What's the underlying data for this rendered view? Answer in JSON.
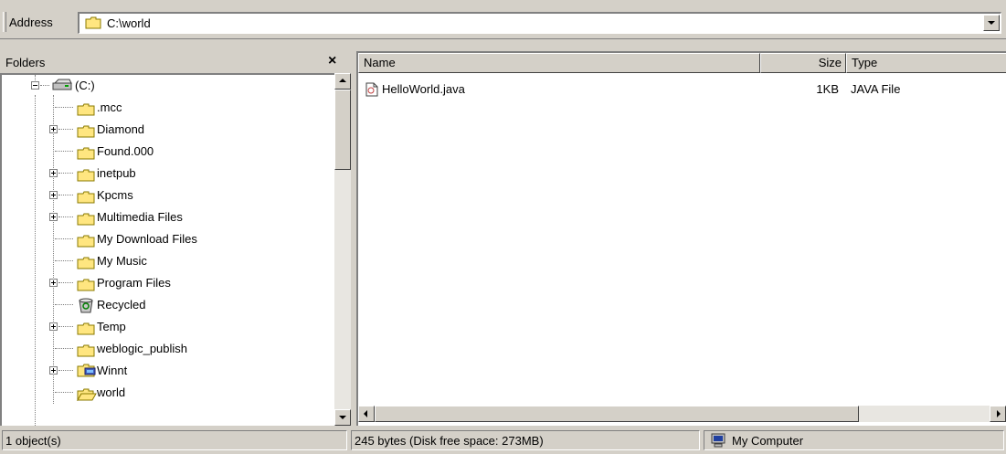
{
  "address_bar": {
    "label": "Address",
    "value": "C:\\world"
  },
  "folders_pane": {
    "title": "Folders",
    "close_label": "×",
    "tree": [
      {
        "label": "(C:)",
        "icon": "drive-icon",
        "expander": "expanded"
      },
      {
        "label": ".mcc",
        "icon": "folder-icon",
        "expander": "none"
      },
      {
        "label": "Diamond",
        "icon": "folder-icon",
        "expander": "collapsed"
      },
      {
        "label": "Found.000",
        "icon": "folder-icon",
        "expander": "none"
      },
      {
        "label": "inetpub",
        "icon": "folder-icon",
        "expander": "collapsed"
      },
      {
        "label": "Kpcms",
        "icon": "folder-icon",
        "expander": "collapsed"
      },
      {
        "label": "Multimedia Files",
        "icon": "folder-icon",
        "expander": "collapsed"
      },
      {
        "label": "My Download Files",
        "icon": "folder-icon",
        "expander": "none"
      },
      {
        "label": "My Music",
        "icon": "folder-icon",
        "expander": "none"
      },
      {
        "label": "Program Files",
        "icon": "folder-icon",
        "expander": "collapsed"
      },
      {
        "label": "Recycled",
        "icon": "recycle-bin-icon",
        "expander": "none"
      },
      {
        "label": "Temp",
        "icon": "folder-icon",
        "expander": "collapsed"
      },
      {
        "label": "weblogic_publish",
        "icon": "folder-icon",
        "expander": "none"
      },
      {
        "label": "Winnt",
        "icon": "system-folder-icon",
        "expander": "collapsed"
      },
      {
        "label": "world",
        "icon": "open-folder-icon",
        "expander": "none",
        "selected": true
      }
    ]
  },
  "file_list": {
    "columns": [
      "Name",
      "Size",
      "Type"
    ],
    "rows": [
      {
        "name": "HelloWorld.java",
        "size": "1KB",
        "type": "JAVA File",
        "icon": "java-file-icon"
      }
    ]
  },
  "status_bar": {
    "objects": "1 object(s)",
    "disk": "245 bytes (Disk free space: 273MB)",
    "zone": "My Computer"
  },
  "colors": {
    "face": "#d4d0c8",
    "folder_yellow": "#ffe680",
    "folder_outline": "#8a7a00"
  }
}
